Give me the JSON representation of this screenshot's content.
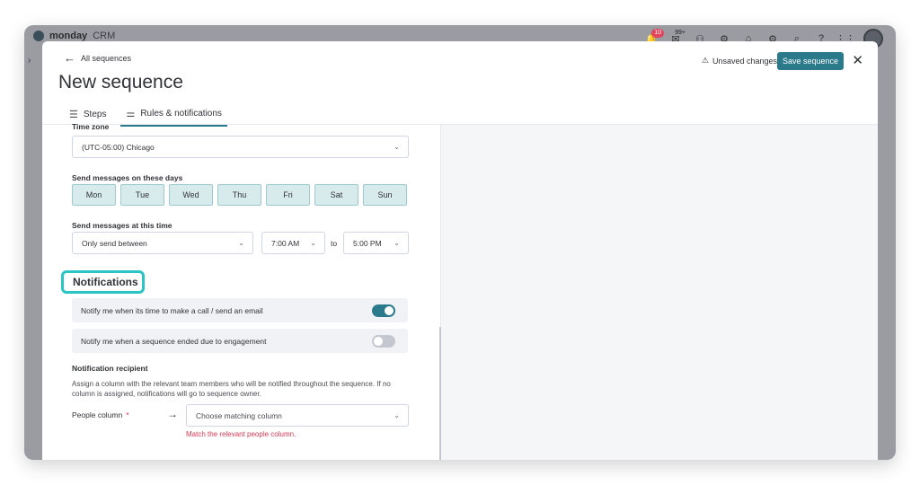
{
  "app": {
    "brand": "monday",
    "brand_suffix": "CRM",
    "notifications_badge": "10",
    "inbox_badge": "99+"
  },
  "header": {
    "back_label": "All sequences",
    "title": "New sequence",
    "unsaved_label": "Unsaved changes",
    "save_label": "Save sequence",
    "close_label": "✕"
  },
  "tabs": [
    {
      "label": "Steps",
      "icon": "list-icon",
      "active": false
    },
    {
      "label": "Rules & notifications",
      "icon": "sliders-icon",
      "active": true
    }
  ],
  "form": {
    "timezone_label": "Time zone",
    "timezone_value": "(UTC-05:00) Chicago",
    "days_label": "Send messages on these days",
    "days": [
      "Mon",
      "Tue",
      "Wed",
      "Thu",
      "Fri",
      "Sat",
      "Sun"
    ],
    "time_label": "Send messages at this time",
    "time_mode": "Only send between",
    "time_from": "7:00 AM",
    "to_label": "to",
    "time_to": "5:00 PM"
  },
  "notifications": {
    "heading": "Notifications",
    "toggle1_label": "Notify me when its time to make a call / send an email",
    "toggle1_on": true,
    "toggle2_label": "Notify me when a sequence ended due to engagement",
    "toggle2_on": false,
    "recipient_label": "Notification recipient",
    "recipient_desc": "Assign a column with the relevant team members who will be notified throughout the sequence. If no column is assigned, notifications will go to sequence owner.",
    "people_label": "People column",
    "required_mark": "*",
    "column_placeholder": "Choose matching column",
    "error_text": "Match the relevant people column."
  },
  "colors": {
    "accent": "#2b7a8c",
    "highlight": "#2bc4c4",
    "error": "#d83a52",
    "day_bg": "#d7ebec"
  }
}
